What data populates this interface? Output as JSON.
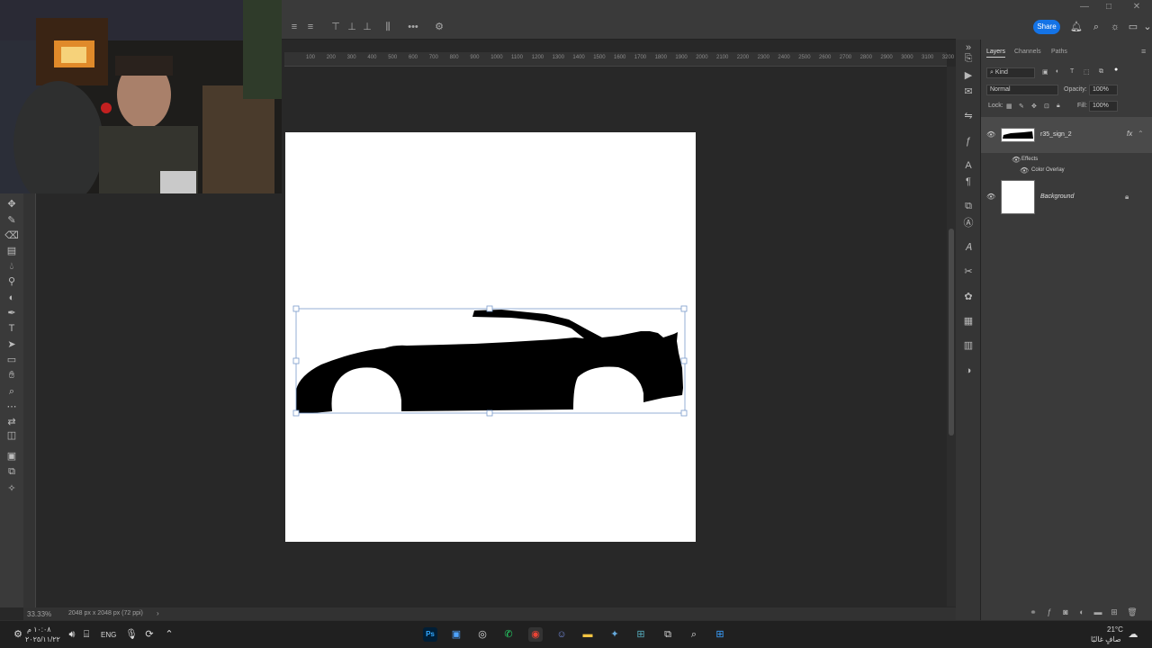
{
  "title_bar": {
    "minimize": "—",
    "maximize": "□",
    "close": "✕"
  },
  "options_bar": {
    "more": "•••",
    "settings": "⚙"
  },
  "top_right": {
    "share_label": "Share"
  },
  "ruler": {
    "ticks": [
      "100",
      "200",
      "300",
      "400",
      "500",
      "600",
      "700",
      "800",
      "900",
      "1000",
      "1100",
      "1200",
      "1300",
      "1400",
      "1500",
      "1600",
      "1700",
      "1800",
      "1900",
      "2000",
      "2100",
      "2200",
      "2300",
      "2400",
      "2500",
      "2600",
      "2700",
      "2800",
      "2900",
      "3000",
      "3100",
      "3200"
    ]
  },
  "layers_panel": {
    "tabs": [
      "Layers",
      "Channels",
      "Paths"
    ],
    "filter_kind": "Kind",
    "blend_mode": "Normal",
    "opacity_label": "Opacity:",
    "opacity_value": "100%",
    "lock_label": "Lock:",
    "fill_label": "Fill:",
    "fill_value": "100%",
    "layers": [
      {
        "name": "r35_sign_2",
        "fx": "fx"
      },
      {
        "name": "Background"
      }
    ],
    "effects_label": "Effects",
    "color_overlay_label": "Color Overlay"
  },
  "status_bar": {
    "zoom": "33.33%",
    "doc_info": "2048 px x 2048 px (72 ppi)"
  },
  "taskbar": {
    "time": "١٠:٠٨ م",
    "date": "٢٠٢٥/١١/٢٢",
    "language": "ENG",
    "temperature": "21°C",
    "weather": "صافٍ غالبًا"
  },
  "colors": {
    "accent": "#1473e6",
    "canvas_bg": "#ffffff",
    "car_fill": "#000000"
  }
}
